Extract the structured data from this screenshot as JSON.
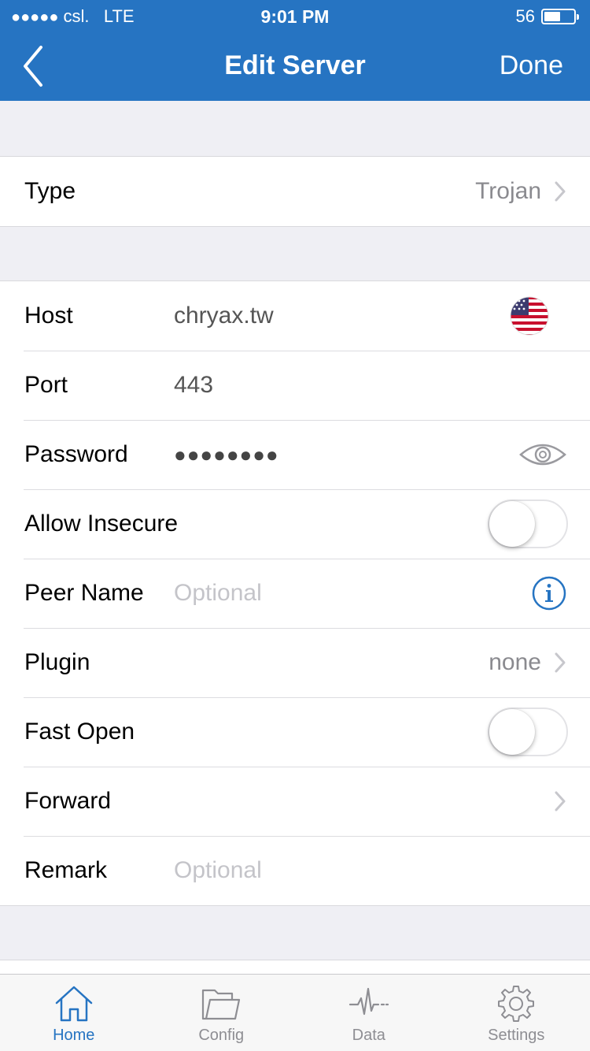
{
  "status_bar": {
    "signal_dots": "●●●●●",
    "carrier": "csl.",
    "network": "LTE",
    "time": "9:01 PM",
    "battery_level": "56"
  },
  "nav": {
    "title": "Edit Server",
    "done_label": "Done"
  },
  "type_row": {
    "label": "Type",
    "value": "Trojan"
  },
  "fields": {
    "host": {
      "label": "Host",
      "value": "chryax.tw",
      "flag": "us-flag-icon"
    },
    "port": {
      "label": "Port",
      "value": "443"
    },
    "password": {
      "label": "Password",
      "value": "●●●●●●●●"
    },
    "allow_insecure": {
      "label": "Allow Insecure",
      "on": false
    },
    "peer_name": {
      "label": "Peer Name",
      "placeholder": "Optional"
    },
    "plugin": {
      "label": "Plugin",
      "value": "none"
    },
    "fast_open": {
      "label": "Fast Open",
      "on": false
    },
    "forward": {
      "label": "Forward"
    },
    "remark": {
      "label": "Remark",
      "placeholder": "Optional"
    }
  },
  "tabs": [
    {
      "label": "Home",
      "icon": "house-icon",
      "active": true
    },
    {
      "label": "Config",
      "icon": "folder-icon",
      "active": false
    },
    {
      "label": "Data",
      "icon": "pulse-icon",
      "active": false
    },
    {
      "label": "Settings",
      "icon": "gear-icon",
      "active": false
    }
  ],
  "colors": {
    "accent": "#2674c2",
    "background": "#efeff4"
  }
}
